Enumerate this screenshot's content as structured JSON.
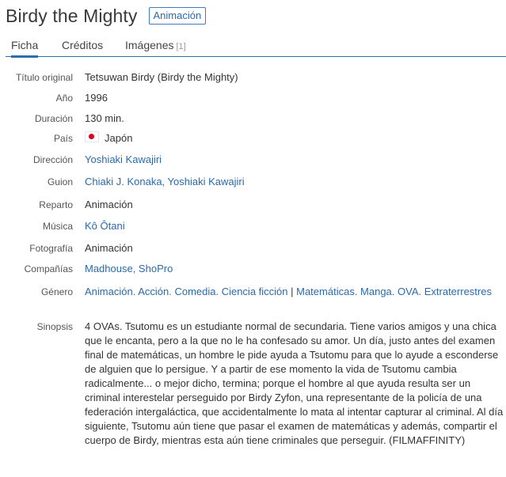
{
  "header": {
    "title": "Birdy the Mighty",
    "badge": "Animación"
  },
  "tabs": [
    {
      "label": "Ficha"
    },
    {
      "label": "Créditos"
    },
    {
      "label": "Imágenes",
      "count": "[1]"
    }
  ],
  "details": {
    "titulo_original": {
      "label": "Título original",
      "value": "Tetsuwan Birdy (Birdy the Mighty)"
    },
    "anio": {
      "label": "Año",
      "value": "1996"
    },
    "duracion": {
      "label": "Duración",
      "value": "130 min."
    },
    "pais": {
      "label": "País",
      "value": "Japón"
    },
    "direccion": {
      "label": "Dirección",
      "value": "Yoshiaki Kawajiri"
    },
    "guion": {
      "label": "Guion",
      "value": "Chiaki J. Konaka, Yoshiaki Kawajiri"
    },
    "reparto": {
      "label": "Reparto",
      "value": "Animación"
    },
    "musica": {
      "label": "Música",
      "value": "Kô Ôtani"
    },
    "fotografia": {
      "label": "Fotografía",
      "value": "Animación"
    },
    "companias": {
      "label": "Compañías",
      "value": "Madhouse, ShoPro"
    },
    "genero": {
      "label": "Género",
      "part1": "Animación. Acción. Comedia. Ciencia ficción",
      "separator": " | ",
      "part2": "Matemáticas. Manga. OVA. Extraterrestres"
    },
    "sinopsis": {
      "label": "Sinopsis",
      "value": "4 OVAs. Tsutomu es un estudiante normal de secundaria. Tiene varios amigos y una chica que le encanta, pero a la que no le ha confesado su amor. Un día, justo antes del examen final de matemáticas, un hombre le pide ayuda a Tsutomu para que lo ayude a esconderse de alguien que lo persigue. Y a partir de ese momento la vida de Tsutomu cambia radicalmente... o mejor dicho, termina; porque el hombre al que ayuda resulta ser un criminal interestelar perseguido por Birdy Zyfon, una representante de la policía de una federación intergaláctica, que accidentalmente lo mata al intentar capturar al criminal. Al día siguiente, Tsutomu aún tiene que pasar el examen de matemáticas y además, compartir el cuerpo de Birdy, mientras esta aún tiene criminales que perseguir. (FILMAFFINITY)"
    }
  },
  "icons": {
    "country_flag": "japan-flag-icon"
  },
  "colors": {
    "accent": "#2f6fa8",
    "link": "#2a6aac",
    "flag_red": "#d8001e"
  }
}
